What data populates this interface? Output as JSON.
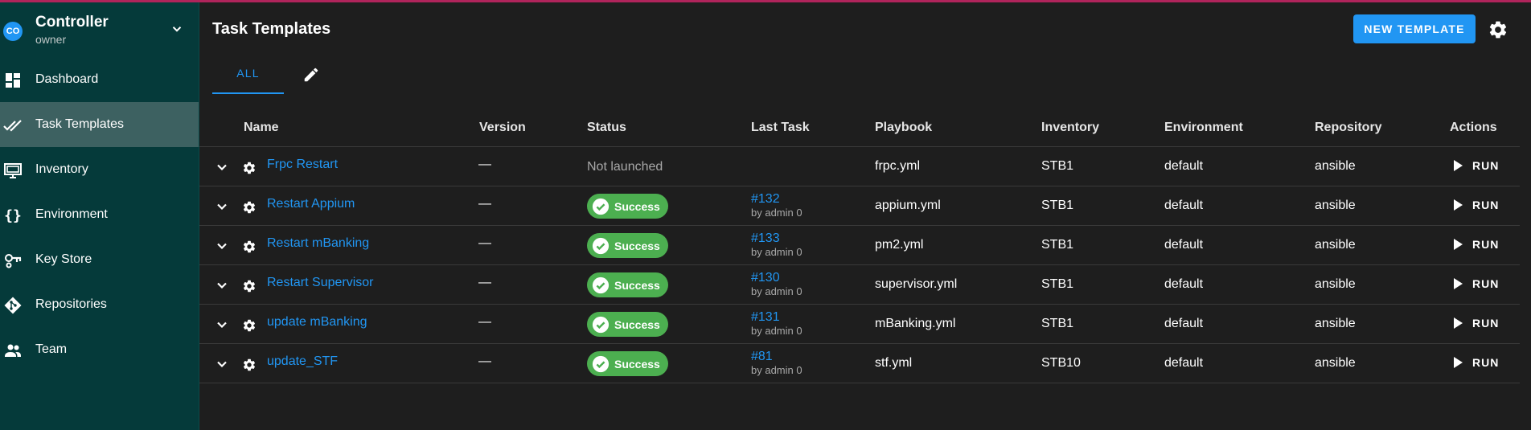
{
  "project": {
    "badge": "CO",
    "name": "Controller",
    "role": "owner"
  },
  "nav": [
    {
      "label": "Dashboard",
      "icon": "dashboard-icon",
      "active": false
    },
    {
      "label": "Task Templates",
      "icon": "double-check-icon",
      "active": true
    },
    {
      "label": "Inventory",
      "icon": "monitor-icon",
      "active": false
    },
    {
      "label": "Environment",
      "icon": "braces-icon",
      "active": false
    },
    {
      "label": "Key Store",
      "icon": "key-icon",
      "active": false
    },
    {
      "label": "Repositories",
      "icon": "git-icon",
      "active": false
    },
    {
      "label": "Team",
      "icon": "team-icon",
      "active": false
    }
  ],
  "header": {
    "title": "Task Templates",
    "new_button": "NEW TEMPLATE"
  },
  "tabs": {
    "all": "ALL"
  },
  "table": {
    "columns": [
      "Name",
      "Version",
      "Status",
      "Last Task",
      "Playbook",
      "Inventory",
      "Environment",
      "Repository",
      "Actions"
    ],
    "rows": [
      {
        "name": "Frpc Restart",
        "version": "—",
        "status": "Not launched",
        "last_task": "",
        "last_by": "",
        "playbook": "frpc.yml",
        "inventory": "STB1",
        "environment": "default",
        "repository": "ansible",
        "action": "RUN"
      },
      {
        "name": "Restart Appium",
        "version": "—",
        "status": "Success",
        "last_task": "#132",
        "last_by": "by admin 0",
        "playbook": "appium.yml",
        "inventory": "STB1",
        "environment": "default",
        "repository": "ansible",
        "action": "RUN"
      },
      {
        "name": "Restart mBanking",
        "version": "—",
        "status": "Success",
        "last_task": "#133",
        "last_by": "by admin 0",
        "playbook": "pm2.yml",
        "inventory": "STB1",
        "environment": "default",
        "repository": "ansible",
        "action": "RUN"
      },
      {
        "name": "Restart Supervisor",
        "version": "—",
        "status": "Success",
        "last_task": "#130",
        "last_by": "by admin 0",
        "playbook": "supervisor.yml",
        "inventory": "STB1",
        "environment": "default",
        "repository": "ansible",
        "action": "RUN"
      },
      {
        "name": "update mBanking",
        "version": "—",
        "status": "Success",
        "last_task": "#131",
        "last_by": "by admin 0",
        "playbook": "mBanking.yml",
        "inventory": "STB1",
        "environment": "default",
        "repository": "ansible",
        "action": "RUN"
      },
      {
        "name": "update_STF",
        "version": "—",
        "status": "Success",
        "last_task": "#81",
        "last_by": "by admin 0",
        "playbook": "stf.yml",
        "inventory": "STB10",
        "environment": "default",
        "repository": "ansible",
        "action": "RUN"
      }
    ]
  },
  "colors": {
    "accent": "#2196f3",
    "sidebar": "#053a3a",
    "success": "#4caf50",
    "background": "#1e1e1e"
  }
}
